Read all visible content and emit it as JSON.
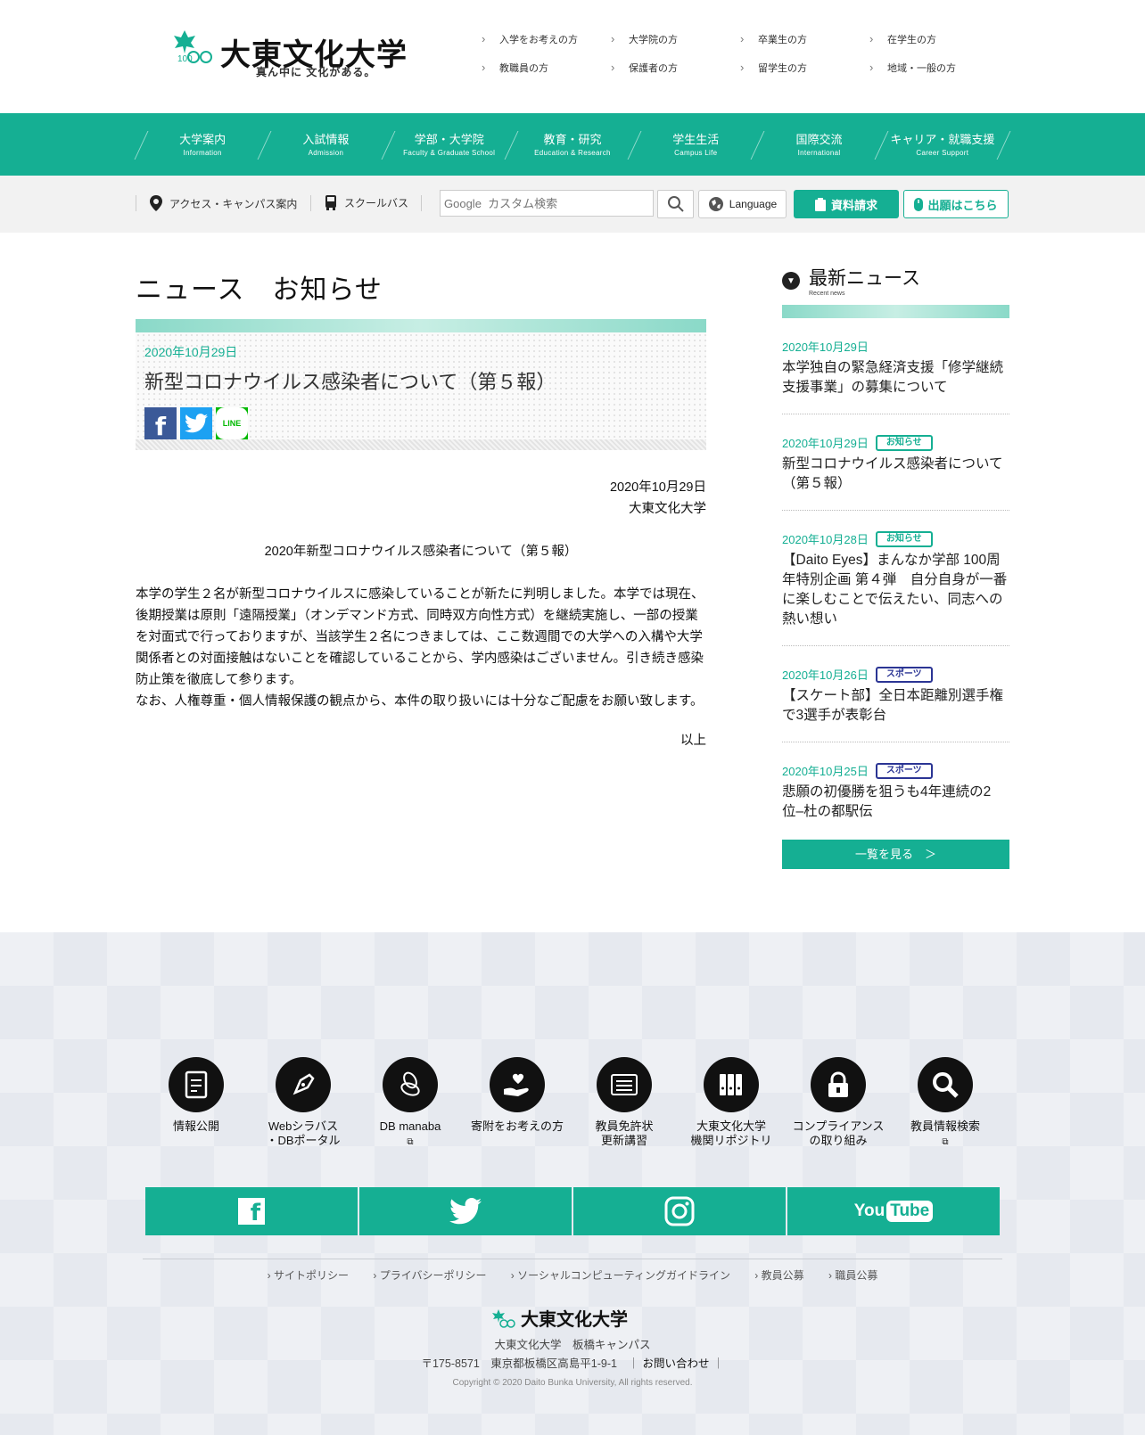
{
  "header": {
    "logo_text": "大東文化大学",
    "logo_tagline": "真ん中に 文化がある。",
    "logo_mark_number": "100",
    "target_links": [
      "入学をお考えの方",
      "大学院の方",
      "卒業生の方",
      "在学生の方",
      "教職員の方",
      "保護者の方",
      "留学生の方",
      "地域・一般の方"
    ]
  },
  "gnav": [
    {
      "ja": "大学案内",
      "en": "Information"
    },
    {
      "ja": "入試情報",
      "en": "Admission"
    },
    {
      "ja": "学部・大学院",
      "en": "Faculty & Graduate School"
    },
    {
      "ja": "教育・研究",
      "en": "Education & Research"
    },
    {
      "ja": "学生生活",
      "en": "Campus Life"
    },
    {
      "ja": "国際交流",
      "en": "International"
    },
    {
      "ja": "キャリア・就職支援",
      "en": "Career Support"
    }
  ],
  "utility": {
    "access": "アクセス・キャンパス案内",
    "bus": "スクールバス",
    "search_placeholder": "Google  カスタム検索",
    "language": "Language",
    "request": "資料請求",
    "apply": "出願はこちら"
  },
  "main": {
    "page_title": "ニュース　お知らせ",
    "article_date": "2020年10月29日",
    "article_title": "新型コロナウイルス感染者について（第５報）",
    "share": {
      "facebook": "f",
      "line": "LINE"
    },
    "body_date": "2020年10月29日",
    "body_author": "大東文化大学",
    "body_heading": "2020年新型コロナウイルス感染者について（第５報）",
    "body_p1": "本学の学生２名が新型コロナウイルスに感染していることが新たに判明しました。本学では現在、後期授業は原則「遠隔授業」（オンデマンド方式、同時双方向性方式）を継続実施し、一部の授業を対面式で行っておりますが、当該学生２名につきましては、ここ数週間での大学への入構や大学関係者との対面接触はないことを確認していることから、学内感染はございません。引き続き感染防止策を徹底して参ります。",
    "body_p2": "なお、人権尊重・個人情報保護の観点から、本件の取り扱いには十分なご配慮をお願い致します。",
    "body_end": "以上"
  },
  "sidebar": {
    "title": "最新ニュース",
    "subtitle": "Recent news",
    "items": [
      {
        "date": "2020年10月29日",
        "tag": "",
        "text": "本学独自の緊急経済支援「修学継続支援事業」の募集について"
      },
      {
        "date": "2020年10月29日",
        "tag": "お知らせ",
        "text": "新型コロナウイルス感染者について（第５報）"
      },
      {
        "date": "2020年10月28日",
        "tag": "お知らせ",
        "text": "【Daito Eyes】まんなか学部 100周年特別企画 第４弾　自分自身が一番に楽しむことで伝えたい、同志への熱い想い"
      },
      {
        "date": "2020年10月26日",
        "tag": "スポーツ",
        "text": "【スケート部】全日本距離別選手権で3選手が表彰台"
      },
      {
        "date": "2020年10月25日",
        "tag": "スポーツ",
        "text": "悲願の初優勝を狙うも4年連続の2位–杜の都駅伝"
      }
    ],
    "list_button": "一覧を見る　＞"
  },
  "footer": {
    "links": [
      {
        "label": "情報公開",
        "label2": "",
        "ext": false
      },
      {
        "label": "Webシラバス",
        "label2": "・DBポータル",
        "ext": false
      },
      {
        "label": "DB manaba",
        "label2": "",
        "ext": true
      },
      {
        "label": "寄附をお考えの方",
        "label2": "",
        "ext": false
      },
      {
        "label": "教員免許状",
        "label2": "更新講習",
        "ext": false
      },
      {
        "label": "大東文化大学",
        "label2": "機関リポジトリ",
        "ext": false
      },
      {
        "label": "コンプライアンス",
        "label2": "の取り組み",
        "ext": false
      },
      {
        "label": "教員情報検索",
        "label2": "",
        "ext": true
      }
    ],
    "sns": {
      "facebook": "f",
      "youtube_a": "You",
      "youtube_b": "Tube"
    },
    "policy_links": [
      "サイトポリシー",
      "プライバシーポリシー",
      "ソーシャルコンピューティングガイドライン",
      "教員公募",
      "職員公募"
    ],
    "logo_text": "大東文化大学",
    "campus": "大東文化大学　板橋キャンパス",
    "address": "〒175-8571　東京都板橋区高島平1-9-1　｜",
    "contact": "お問い合わせ",
    "address_end": "｜",
    "copyright": "Copyright © 2020 Daito Bunka University, All rights reserved."
  },
  "colors": {
    "accent": "#15af93",
    "sport": "#2b3594"
  }
}
